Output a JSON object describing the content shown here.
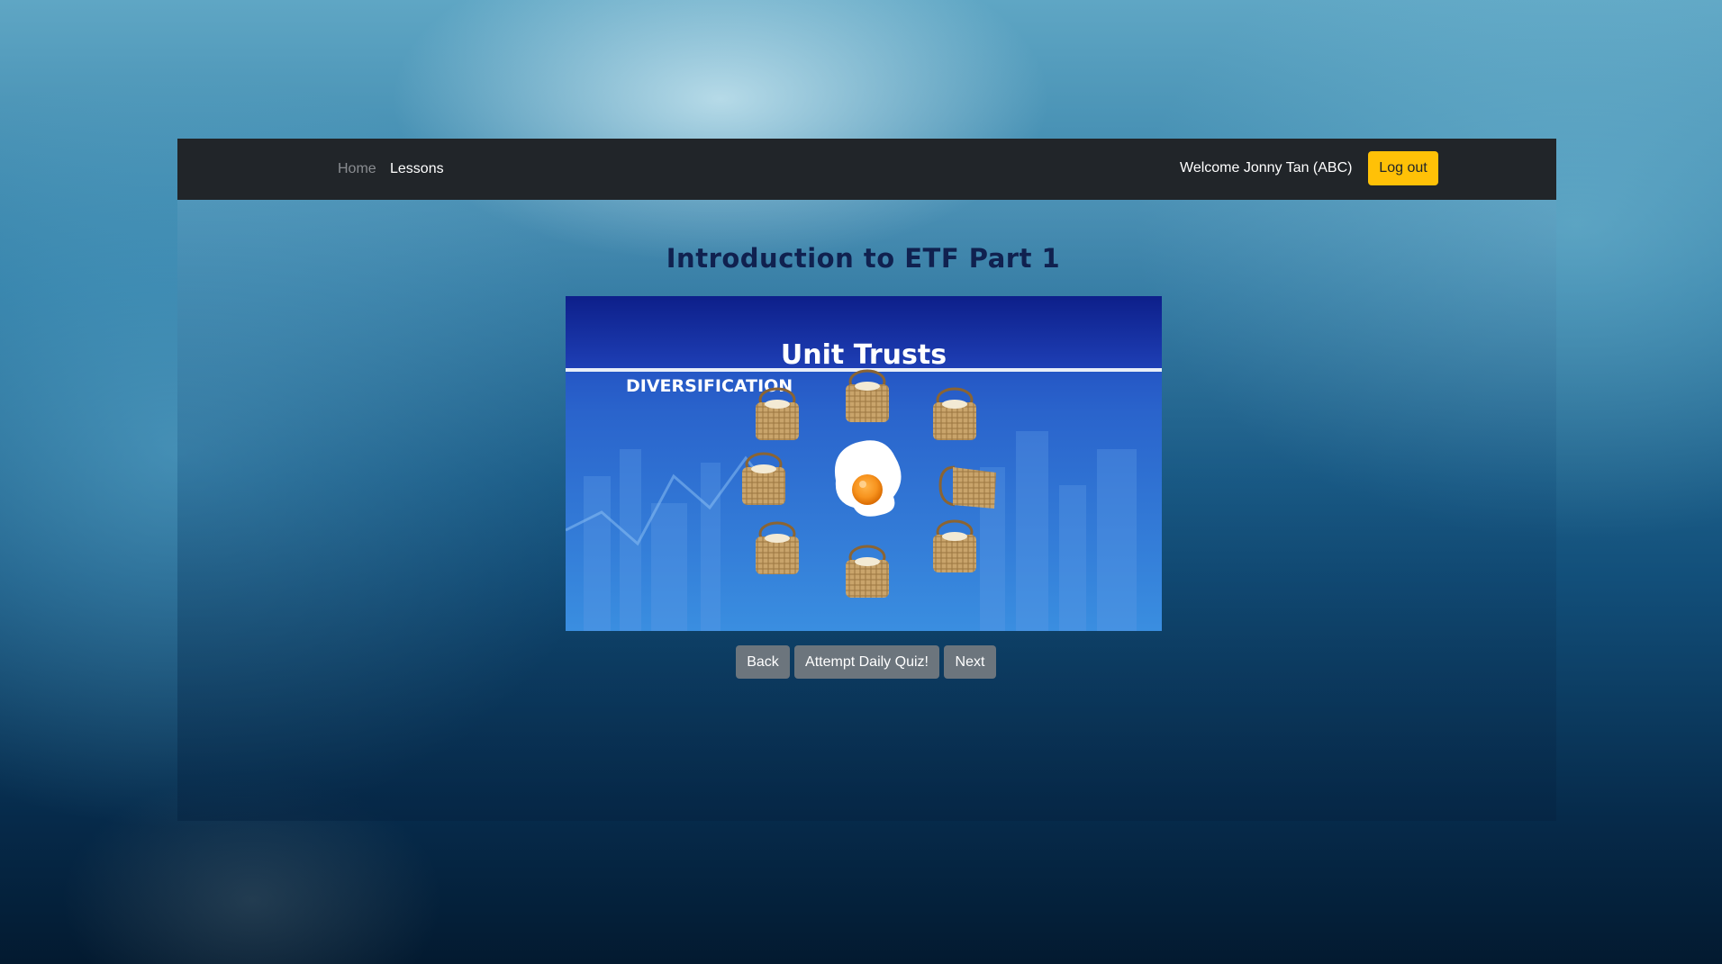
{
  "nav": {
    "home_label": "Home",
    "lessons_label": "Lessons",
    "welcome_text": "Welcome Jonny Tan (ABC)",
    "logout_label": "Log out"
  },
  "lesson": {
    "title": "Introduction to ETF Part 1",
    "slide": {
      "heading": "Unit Trusts",
      "subheading": "DIVERSIFICATION"
    }
  },
  "actions": {
    "back_label": "Back",
    "quiz_label": "Attempt Daily Quiz!",
    "next_label": "Next"
  },
  "colors": {
    "navbar": "#212529",
    "logout_button": "#ffc107",
    "secondary_button": "#6c757d",
    "title": "#10214f"
  }
}
